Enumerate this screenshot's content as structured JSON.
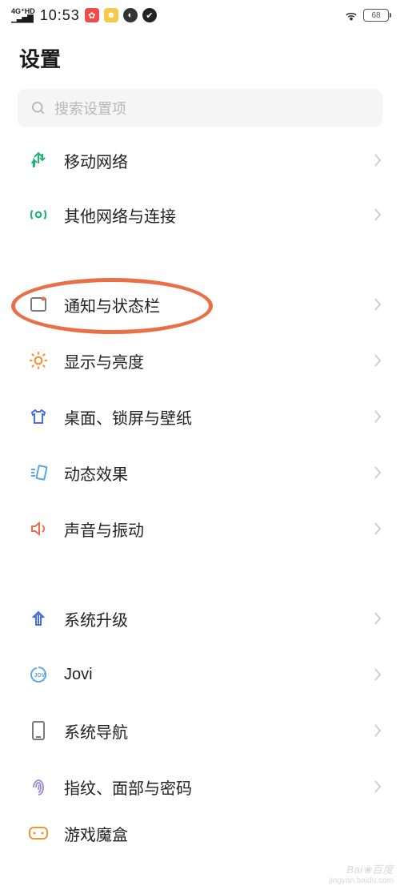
{
  "status": {
    "network_type": "4G⁺HD",
    "time": "10:53",
    "battery": "68"
  },
  "page_title": "设置",
  "search": {
    "placeholder": "搜索设置项"
  },
  "items": {
    "mobile_network": "移动网络",
    "other_connections": "其他网络与连接",
    "notifications_status": "通知与状态栏",
    "display_brightness": "显示与亮度",
    "desktop_lock_wallpaper": "桌面、锁屏与壁纸",
    "dynamic_effect": "动态效果",
    "sound_vibration": "声音与振动",
    "system_upgrade": "系统升级",
    "jovi": "Jovi",
    "system_navigation": "系统导航",
    "fingerprint_face_password": "指纹、面部与密码",
    "game_box": "游戏魔盒"
  },
  "watermark": {
    "line1": "Bai❀百度",
    "line2": "jingyan.baidu.com"
  },
  "colors": {
    "green": "#1fb574",
    "orange": "#f3933a",
    "blue": "#4a6de0",
    "lightblue": "#5aa7e8",
    "red_orange": "#f06c4a",
    "gray": "#7a7a7a",
    "purple": "#9a8ad4",
    "ring": "#ea6e46"
  }
}
